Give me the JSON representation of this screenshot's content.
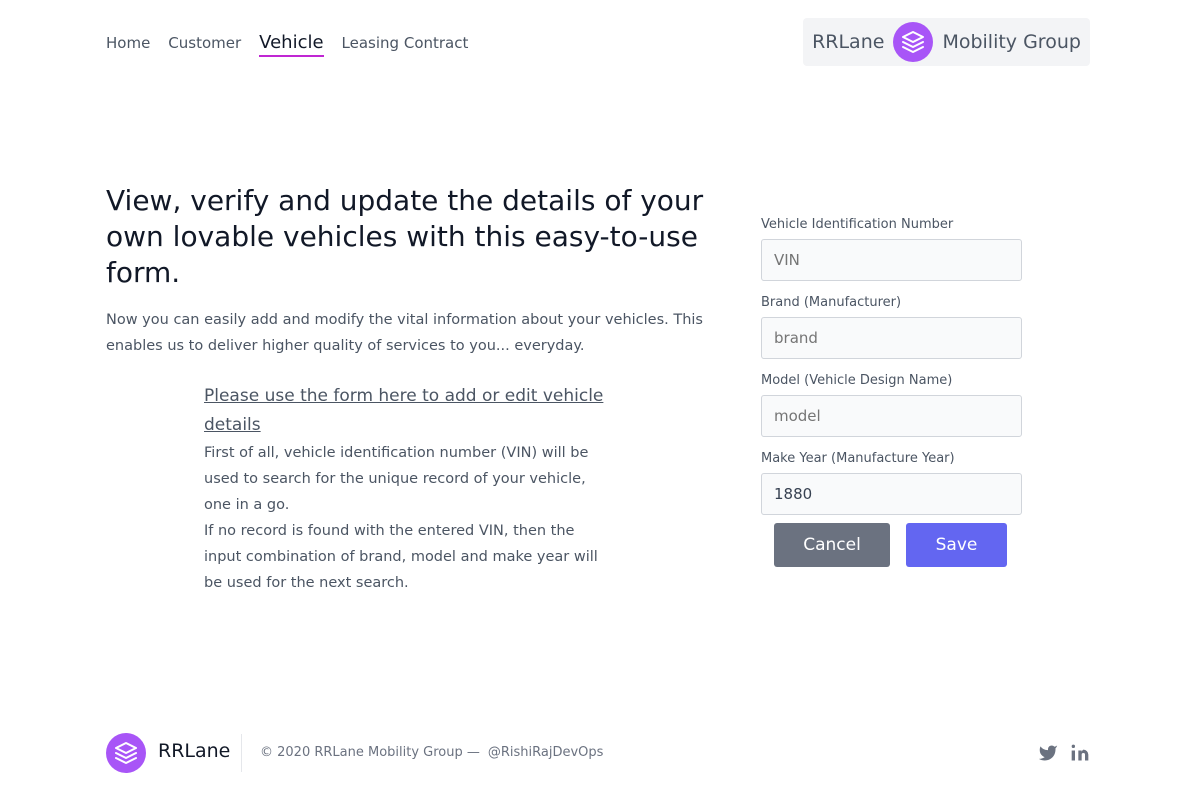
{
  "nav": {
    "items": [
      {
        "label": "Home"
      },
      {
        "label": "Customer"
      },
      {
        "label": "Vehicle",
        "active": true
      },
      {
        "label": "Leasing Contract"
      }
    ]
  },
  "brand": {
    "name_left": "RRLane",
    "name_right": "Mobility Group",
    "logo_icon": "layers-icon",
    "accent_color": "#a855f7"
  },
  "hero": {
    "heading": "View, verify and update the details of your own lovable vehicles with this easy-to-use form.",
    "lead": "Now you can easily add and modify the vital information about your vehicles. This enables us to deliver higher quality of services to you... everyday."
  },
  "info": {
    "link": "Please use the form here to add or edit vehicle details",
    "para1": "First of all, vehicle identification number (VIN) will be used to search for the unique record of your vehicle, one in a go.",
    "para2": "If no record is found with the entered VIN, then the input combination of brand, model and make year will be used for the next search."
  },
  "form": {
    "fields": [
      {
        "label": "Vehicle Identification Number",
        "placeholder": "VIN",
        "value": ""
      },
      {
        "label": "Brand (Manufacturer)",
        "placeholder": "brand",
        "value": ""
      },
      {
        "label": "Model (Vehicle Design Name)",
        "placeholder": "model",
        "value": ""
      },
      {
        "label": "Make Year (Manufacture Year)",
        "placeholder": "",
        "value": "1880"
      }
    ],
    "cancel_label": "Cancel",
    "save_label": "Save"
  },
  "footer": {
    "brand": "RRLane",
    "copyright": "© 2020 RRLane Mobility Group —",
    "handle": "@RishiRajDevOps",
    "social_icons": [
      "twitter-icon",
      "linkedin-icon"
    ]
  }
}
